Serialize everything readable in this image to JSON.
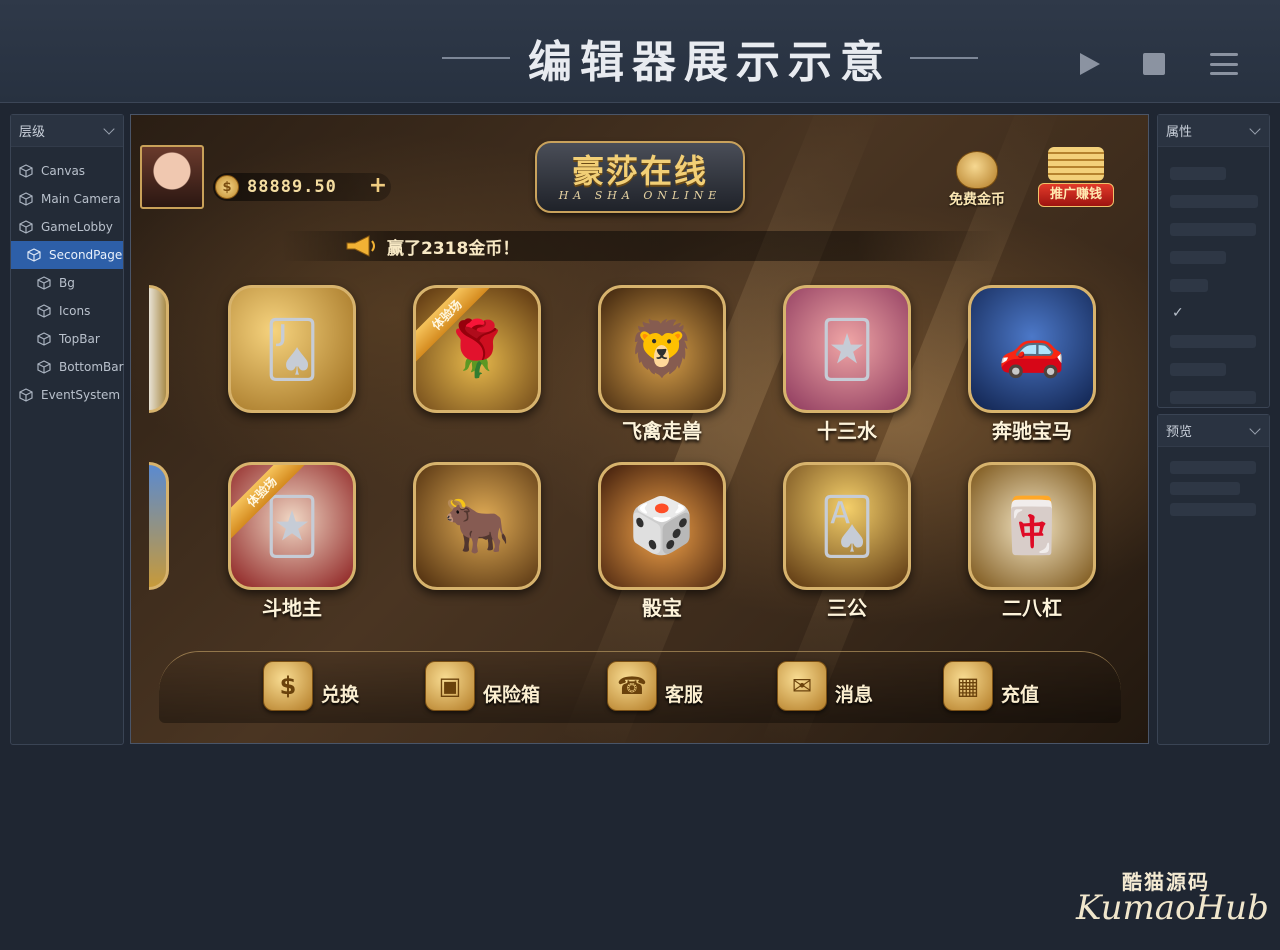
{
  "header": {
    "title": "编辑器展示示意",
    "play_icon": "play-icon",
    "stop_icon": "stop-icon",
    "menu_icon": "menu-icon"
  },
  "hierarchy": {
    "title": "层级",
    "items": [
      {
        "label": "Canvas",
        "level": 0
      },
      {
        "label": "Main Camera",
        "level": 0
      },
      {
        "label": "GameLobby",
        "level": 0
      },
      {
        "label": "SecondPage",
        "level": 1,
        "selected": true
      },
      {
        "label": "Bg",
        "level": 2
      },
      {
        "label": "Icons",
        "level": 2
      },
      {
        "label": "TopBar",
        "level": 2
      },
      {
        "label": "BottomBar",
        "level": 2
      },
      {
        "label": "EventSystem",
        "level": 0
      }
    ]
  },
  "properties": {
    "title": "属性",
    "check_mark": "✓"
  },
  "preview": {
    "title": "预览"
  },
  "game": {
    "coins": "88889.50",
    "logo_cn": "豪莎在线",
    "logo_en": "HA SHA ONLINE",
    "free_coins": "免费金币",
    "promo": "推广赚钱",
    "marquee": "赢了2318金币！",
    "trial_tag": "体验场",
    "tiles": [
      {
        "label": "",
        "glyph": "🂫",
        "trial": false
      },
      {
        "label": "",
        "glyph": "🌹",
        "trial": true
      },
      {
        "label": "飞禽走兽",
        "glyph": "🦁",
        "trial": false
      },
      {
        "label": "十三水",
        "glyph": "🃏",
        "trial": false
      },
      {
        "label": "奔驰宝马",
        "glyph": "🚗",
        "trial": false
      },
      {
        "label": "斗地主",
        "glyph": "🃏",
        "trial": true
      },
      {
        "label": "",
        "glyph": "🐂",
        "trial": false
      },
      {
        "label": "骰宝",
        "glyph": "🎲",
        "trial": false
      },
      {
        "label": "三公",
        "glyph": "🂡",
        "trial": false
      },
      {
        "label": "二八杠",
        "glyph": "🀄",
        "trial": false
      }
    ],
    "bottom": [
      {
        "label": "兑换",
        "glyph": "$"
      },
      {
        "label": "保险箱",
        "glyph": "▣"
      },
      {
        "label": "客服",
        "glyph": "☎"
      },
      {
        "label": "消息",
        "glyph": "✉"
      },
      {
        "label": "充值",
        "glyph": "▦"
      }
    ]
  },
  "watermark": {
    "cn": "酷猫源码",
    "en": "KumaoHub"
  },
  "colors": {
    "accent": "#2d5fa8",
    "gold": "#d7b36d",
    "bg": "#1f2632"
  }
}
